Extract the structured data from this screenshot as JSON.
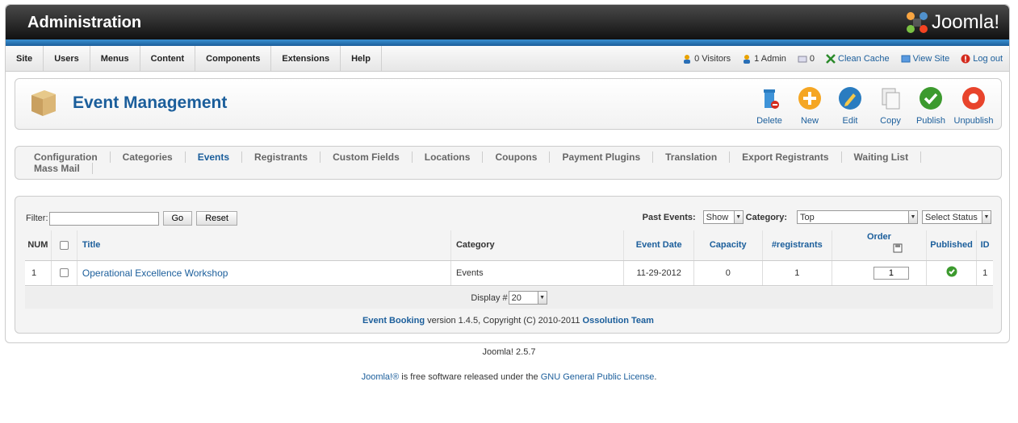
{
  "header": {
    "title": "Administration",
    "logo_text": "Joomla!"
  },
  "menu": [
    "Site",
    "Users",
    "Menus",
    "Content",
    "Components",
    "Extensions",
    "Help"
  ],
  "status": {
    "visitors": "0 Visitors",
    "admins": "1 Admin",
    "messages": "0",
    "clean_cache": "Clean Cache",
    "view_site": "View Site",
    "logout": "Log out"
  },
  "toolbar": {
    "title": "Event Management",
    "buttons": [
      "Delete",
      "New",
      "Edit",
      "Copy",
      "Publish",
      "Unpublish"
    ]
  },
  "tabs": [
    "Configuration",
    "Categories",
    "Events",
    "Registrants",
    "Custom Fields",
    "Locations",
    "Coupons",
    "Payment Plugins",
    "Translation",
    "Export Registrants",
    "Waiting List",
    "Mass Mail"
  ],
  "filter": {
    "label": "Filter:",
    "value": "",
    "go": "Go",
    "reset": "Reset"
  },
  "right_filters": {
    "past_label": "Past Events:",
    "past_value": "Show",
    "category_label": "Category:",
    "category_value": "Top",
    "status_value": "Select Status"
  },
  "table": {
    "headers": [
      "NUM",
      "Title",
      "Category",
      "Event Date",
      "Capacity",
      "#registrants",
      "Order",
      "Published",
      "ID"
    ],
    "rows": [
      {
        "num": "1",
        "title": "Operational Excellence Workshop",
        "category": "Events",
        "date": "11-29-2012",
        "capacity": "0",
        "registrants": "1",
        "order": "1",
        "id": "1"
      }
    ]
  },
  "display": {
    "label": "Display #",
    "value": "20"
  },
  "footer": {
    "product": "Event Booking",
    "version": " version 1.4.5, Copyright (C) 2010-2011 ",
    "team": "Ossolution Team"
  },
  "joomla_version": "Joomla! 2.5.7",
  "license": {
    "joomla": "Joomla!®",
    "text1": " is free software released under the ",
    "gnu": "GNU General Public License",
    "text2": "."
  },
  "colors": {
    "accent": "#1b5e9b",
    "header": "#1a1a1a"
  }
}
